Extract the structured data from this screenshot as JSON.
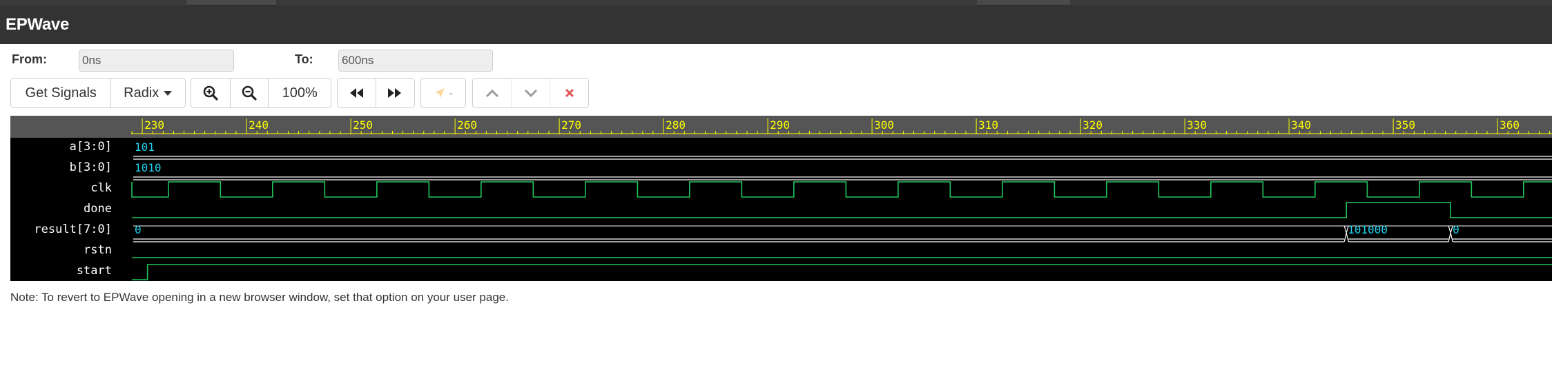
{
  "app": {
    "title": "EPWave"
  },
  "range": {
    "from_label": "From:",
    "from_value": "0ns",
    "to_label": "To:",
    "to_value": "600ns"
  },
  "toolbar": {
    "get_signals": "Get Signals",
    "radix": "Radix",
    "zoom_level": "100%",
    "cursor_value": "-"
  },
  "ruler": {
    "ticks": [
      "230",
      "240",
      "250",
      "260",
      "270",
      "280",
      "290",
      "300",
      "310",
      "320",
      "330",
      "340",
      "350",
      "360"
    ]
  },
  "signals": [
    {
      "name": "a[3:0]",
      "value": "101"
    },
    {
      "name": "b[3:0]",
      "value": "1010"
    },
    {
      "name": "clk"
    },
    {
      "name": "done"
    },
    {
      "name": "result[7:0]",
      "values": [
        "0",
        "101000",
        "0"
      ]
    },
    {
      "name": "rstn"
    },
    {
      "name": "start"
    }
  ],
  "colors": {
    "header_bg": "#333333",
    "wave_bg": "#000000",
    "ruler_bg": "#555555",
    "ruler_text": "#ffff00",
    "signal_green": "#22c55e",
    "value_cyan": "#22d3ee",
    "bus_white": "#ffffff"
  },
  "note": "Note: To revert to EPWave opening in a new browser window, set that option on your user page."
}
